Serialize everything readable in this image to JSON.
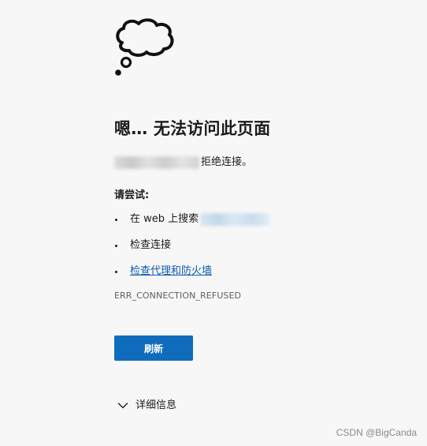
{
  "error_page": {
    "title": "嗯… 无法访问此页面",
    "description_suffix": "拒绝连接。",
    "try_label": "请尝试:",
    "suggestions": [
      {
        "text": "在 web 上搜索"
      },
      {
        "text": "检查连接"
      },
      {
        "text": "检查代理和防火墙",
        "is_link": true
      }
    ],
    "error_code": "ERR_CONNECTION_REFUSED",
    "refresh_label": "刷新",
    "details_label": "详细信息"
  },
  "icons": {
    "cloud": "thought-cloud-icon",
    "details": "chevron-down-icon"
  },
  "colors": {
    "background": "#f7f7f7",
    "text": "#1b1b1b",
    "accent": "#0f6cbd",
    "link": "#0b5cad",
    "muted": "#5f5f5f"
  },
  "watermark": "CSDN @BigCanda"
}
